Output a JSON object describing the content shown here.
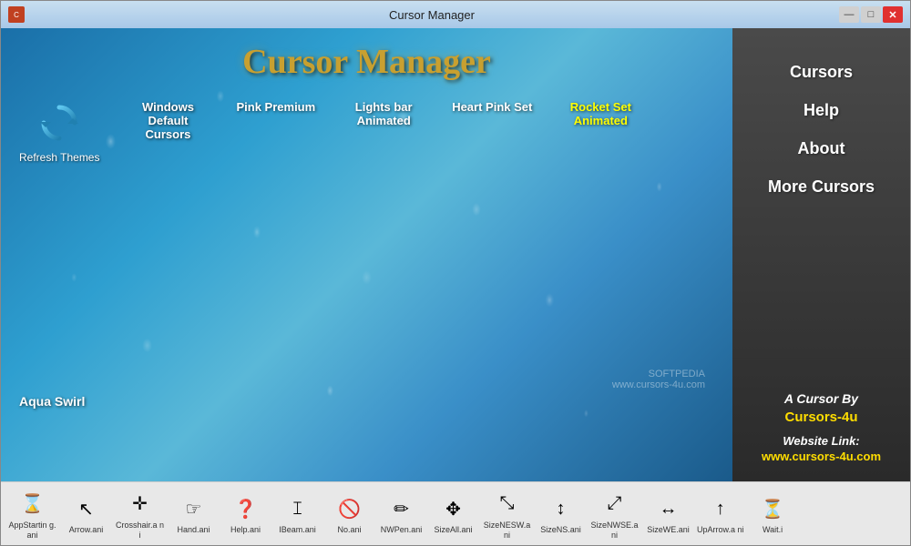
{
  "window": {
    "title": "Cursor Manager",
    "icon_color": "#c04020"
  },
  "titlebar": {
    "minimize": "—",
    "maximize": "□",
    "close": "✕"
  },
  "app": {
    "title": "Cursor Manager"
  },
  "refresh": {
    "label": "Refresh Themes"
  },
  "themes": [
    {
      "id": "windows-default",
      "label": "Windows Default Cursors",
      "active": false
    },
    {
      "id": "pink-premium",
      "label": "Pink Premium",
      "active": false
    },
    {
      "id": "lights-bar",
      "label": "Lights bar Animated",
      "active": false
    },
    {
      "id": "heart-pink",
      "label": "Heart Pink Set",
      "active": false
    },
    {
      "id": "rocket-set",
      "label": "Rocket Set Animated",
      "active": true
    }
  ],
  "extra_theme": "Aqua Swirl",
  "watermark": {
    "line1": "SOFTPEDIA",
    "line2": "www.cursors-4u.com"
  },
  "nav": {
    "items": [
      {
        "id": "cursors",
        "label": "Cursors"
      },
      {
        "id": "help",
        "label": "Help"
      },
      {
        "id": "about",
        "label": "About"
      },
      {
        "id": "more-cursors",
        "label": "More Cursors"
      }
    ]
  },
  "footer": {
    "prefix": "A Cursor By",
    "brand": "Cursors-4u",
    "website_label": "Website Link:",
    "url": "www.cursors-4u.com"
  },
  "cursors": [
    {
      "label": "AppStartin\ng.ani",
      "icon": "⌛"
    },
    {
      "label": "Arrow.ani",
      "icon": "↖"
    },
    {
      "label": "Crosshair.a\nni",
      "icon": "✛"
    },
    {
      "label": "Hand.ani",
      "icon": "☞"
    },
    {
      "label": "Help.ani",
      "icon": "❓"
    },
    {
      "label": "IBeam.ani",
      "icon": "𝙸"
    },
    {
      "label": "No.ani",
      "icon": "🚫"
    },
    {
      "label": "NWPen.ani",
      "icon": "✏"
    },
    {
      "label": "SizeAll.ani",
      "icon": "✥"
    },
    {
      "label": "SizeNESW.a\nni",
      "icon": "⤡"
    },
    {
      "label": "SizeNS.ani",
      "icon": "↕"
    },
    {
      "label": "SizeNWSE.a\nni",
      "icon": "⤢"
    },
    {
      "label": "SizeWE.ani",
      "icon": "↔"
    },
    {
      "label": "UpArrow.a\nni",
      "icon": "↑"
    },
    {
      "label": "Wait.i",
      "icon": "⏳"
    }
  ]
}
